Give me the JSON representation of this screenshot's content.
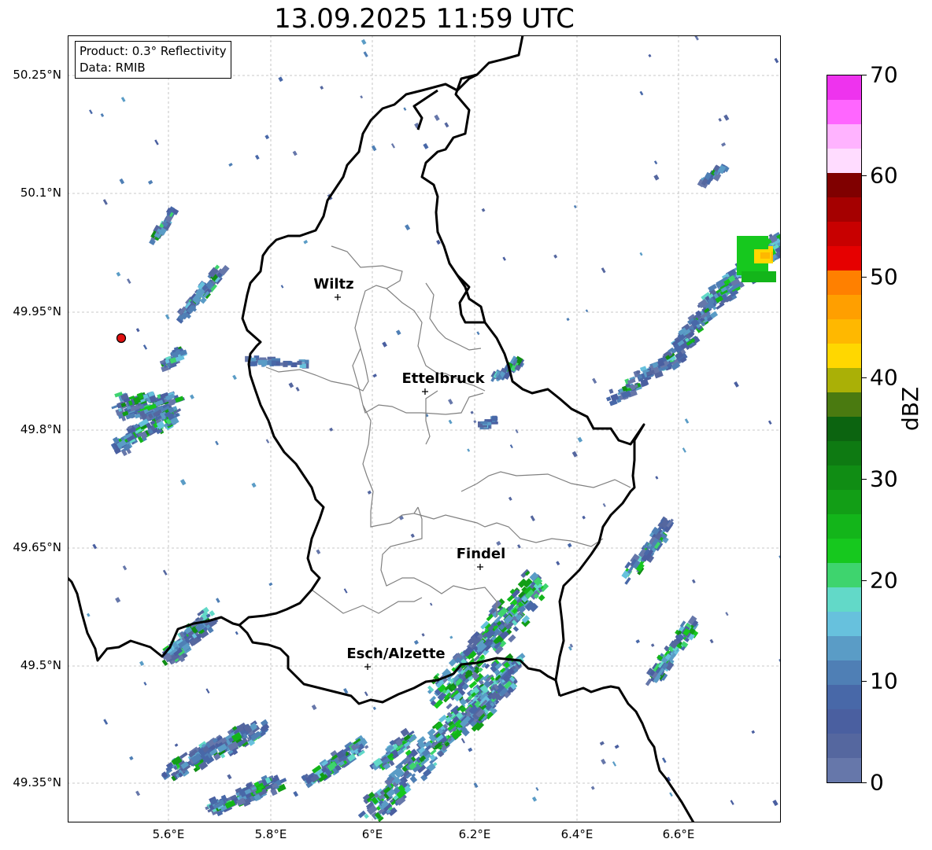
{
  "title": "13.09.2025 11:59 UTC",
  "infobox": {
    "product": "Product: 0.3° Reflectivity",
    "data": "Data: RMIB"
  },
  "lat_labels": [
    "50.25°N",
    "50.1°N",
    "49.95°N",
    "49.8°N",
    "49.65°N",
    "49.5°N",
    "49.35°N"
  ],
  "lon_labels": [
    "5.6°E",
    "5.8°E",
    "6°E",
    "6.2°E",
    "6.4°E",
    "6.6°E"
  ],
  "cities": [
    {
      "name": "Wiltz"
    },
    {
      "name": "Ettelbruck"
    },
    {
      "name": "Findel"
    },
    {
      "name": "Esch/Alzette"
    }
  ],
  "colorbar": {
    "label": "dBZ",
    "ticks": [
      "0",
      "10",
      "20",
      "30",
      "40",
      "50",
      "60",
      "70"
    ],
    "min": 0,
    "max": 70,
    "colors": [
      "#6677aa",
      "#55679f",
      "#4a5fa0",
      "#4868a8",
      "#4f7fb5",
      "#5a9cc6",
      "#67c1dd",
      "#62d9c8",
      "#3ed46e",
      "#16c81e",
      "#13b51a",
      "#129e16",
      "#108d14",
      "#0e7a12",
      "#0c6410",
      "#4a7a10",
      "#aab006",
      "#ffd700",
      "#ffb800",
      "#ff9f00",
      "#ff8000",
      "#e60000",
      "#c80000",
      "#a50000",
      "#800000",
      "#ffdcff",
      "#ffb3ff",
      "#ff66ff",
      "#ee33ee"
    ]
  },
  "radar_marker": {
    "color": "#e01010"
  }
}
